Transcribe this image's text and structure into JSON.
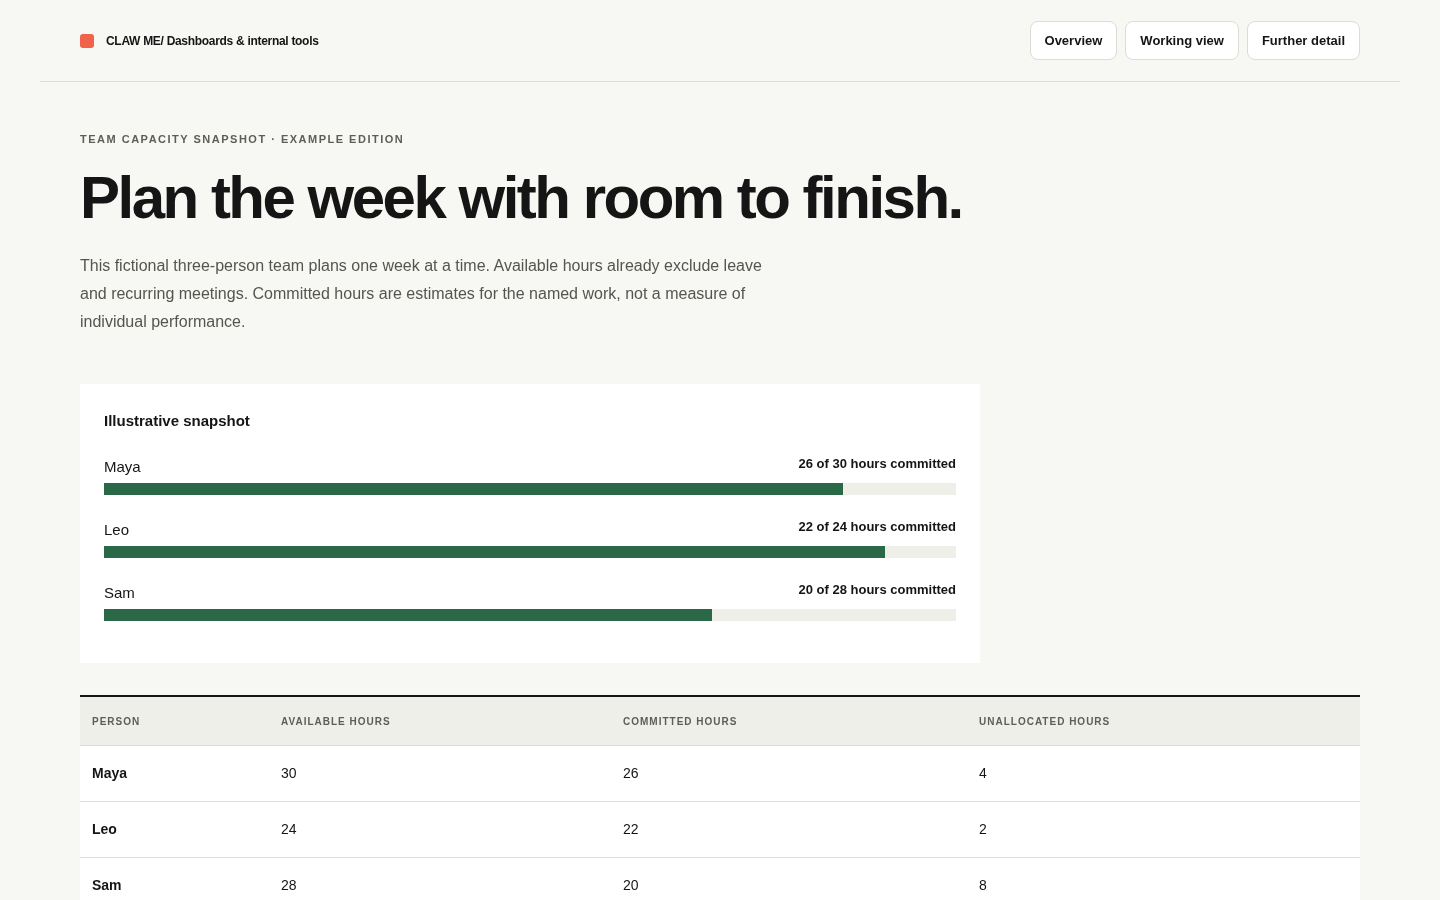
{
  "header": {
    "brand": "CLAW ME/ Dashboards & internal tools",
    "nav": [
      "Overview",
      "Working view",
      "Further detail"
    ]
  },
  "eyebrow": "TEAM CAPACITY SNAPSHOT · EXAMPLE EDITION",
  "title": "Plan the week with room to finish.",
  "intro": "This fictional three-person team plans one week at a time. Available hours already exclude leave and recurring meetings. Committed hours are estimates for the named work, not a measure of individual performance.",
  "snapshot": {
    "title": "Illustrative snapshot",
    "rows": [
      {
        "name": "Maya",
        "reading": "26 of 30 hours committed",
        "level": 0.867
      },
      {
        "name": "Leo",
        "reading": "22 of 24 hours committed",
        "level": 0.917
      },
      {
        "name": "Sam",
        "reading": "20 of 28 hours committed",
        "level": 0.714
      }
    ]
  },
  "table": {
    "columns": [
      "PERSON",
      "AVAILABLE HOURS",
      "COMMITTED HOURS",
      "UNALLOCATED HOURS"
    ],
    "rows": [
      [
        "Maya",
        "30",
        "26",
        "4"
      ],
      [
        "Leo",
        "24",
        "22",
        "2"
      ],
      [
        "Sam",
        "28",
        "20",
        "8"
      ]
    ]
  }
}
